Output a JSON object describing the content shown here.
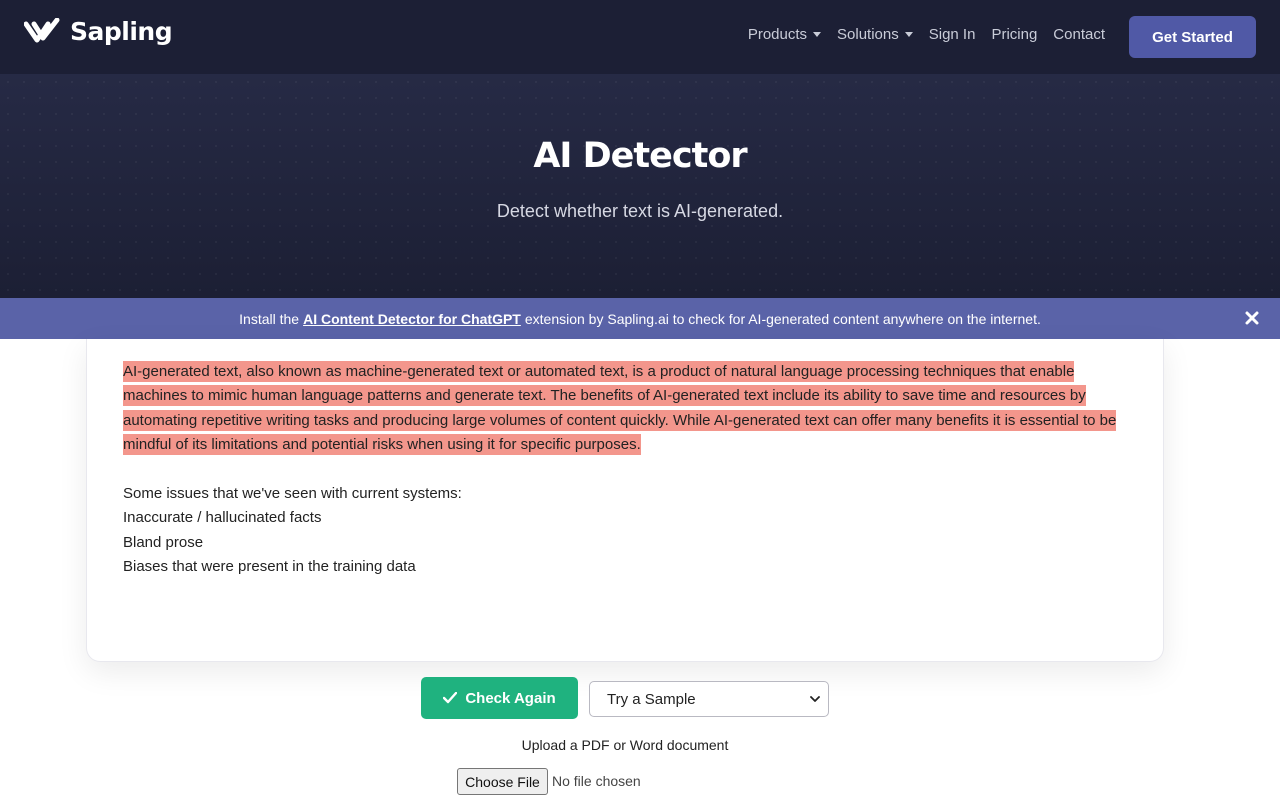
{
  "header": {
    "brand": "Sapling",
    "nav": [
      {
        "label": "Products",
        "dropdown": true
      },
      {
        "label": "Solutions",
        "dropdown": true
      },
      {
        "label": "Sign In",
        "dropdown": false
      },
      {
        "label": "Pricing",
        "dropdown": false
      },
      {
        "label": "Contact",
        "dropdown": false
      }
    ],
    "cta_label": "Get Started"
  },
  "hero": {
    "title": "AI Detector",
    "subtitle": "Detect whether text is AI-generated."
  },
  "banner": {
    "prefix": "Install the",
    "link": "AI Content Detector for ChatGPT",
    "suffix": "extension by Sapling.ai to check for AI-generated content anywhere on the internet."
  },
  "editor": {
    "highlighted_text": "AI-generated text, also known as machine-generated text or automated text, is a product of natural language processing techniques that enable machines to mimic human language patterns and generate text. The benefits of AI-generated text include its ability to save time and resources by automating repetitive writing tasks and producing large volumes of content quickly. While AI-generated text can offer many benefits it is essential to be mindful of its limitations and potential risks when using it for specific purposes.",
    "lines": [
      "Some issues that we've seen with current systems:",
      "Inaccurate / hallucinated facts",
      "Bland prose",
      "Biases that were present in the training data"
    ]
  },
  "controls": {
    "check_label": "Check Again",
    "sample_selected": "Try a Sample",
    "upload_label": "Upload a PDF or Word document",
    "file_button": "Choose File",
    "file_status": "No file chosen"
  },
  "colors": {
    "header_bg": "#1c1f35",
    "cta_bg": "#5059a6",
    "banner_bg": "#5a63a8",
    "highlight": "#f3968c",
    "check_button": "#1fb27f"
  }
}
